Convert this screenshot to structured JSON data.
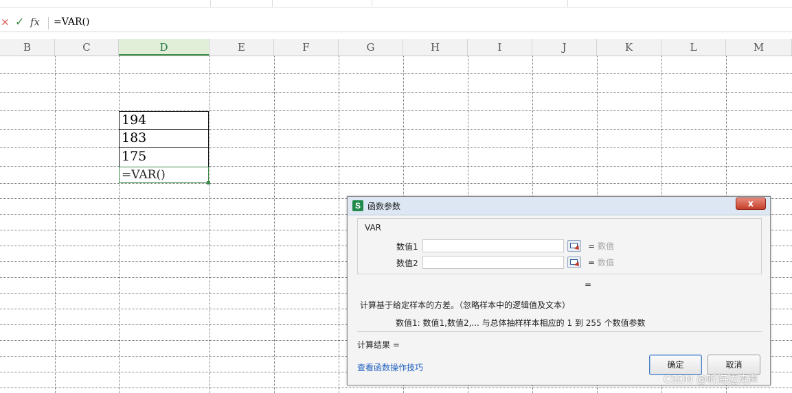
{
  "formula_bar": {
    "cancel_icon": "×",
    "enter_icon": "✓",
    "fx_label": "fx",
    "formula": "=VAR()"
  },
  "columns": [
    "B",
    "C",
    "D",
    "E",
    "F",
    "G",
    "H",
    "I",
    "J",
    "K",
    "L",
    "M"
  ],
  "selected_column": "D",
  "cells": {
    "d1": "194",
    "d2": "183",
    "d3": "175",
    "active": "=VAR()"
  },
  "dialog": {
    "app_icon": "S",
    "title": "函数参数",
    "close_icon": "x",
    "function_name": "VAR",
    "args": [
      {
        "label": "数值1",
        "value": "",
        "eq": "=",
        "hint": "数值"
      },
      {
        "label": "数值2",
        "value": "",
        "eq": "=",
        "hint": "数值"
      }
    ],
    "result_eq": "=",
    "description": "计算基于给定样本的方差。（忽略样本中的逻辑值及文本）",
    "arg_description": "数值1:   数值1,数值2,... 与总体抽样样本相应的 1 到 255 个数值参数",
    "calc_result": "计算结果  =",
    "tips_link": "查看函数操作技巧",
    "ok_label": "确定",
    "cancel_label": "取消"
  },
  "watermark": "CSDN @听海边涛声"
}
